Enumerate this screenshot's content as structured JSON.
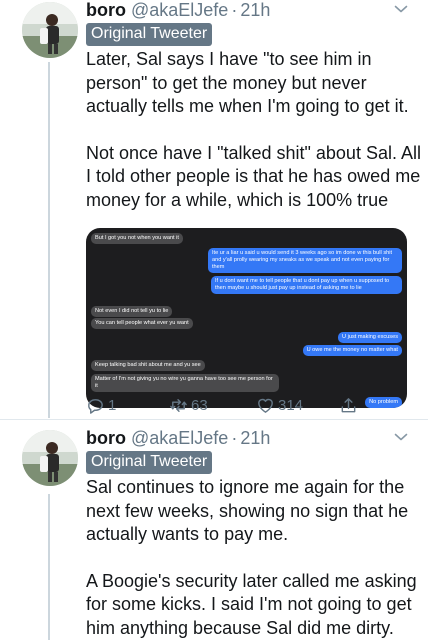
{
  "tweets": [
    {
      "name": "boro",
      "handle": "@akaElJefe",
      "time": "21h",
      "badge": "Original Tweeter",
      "lines": [
        "Later, Sal says I have \"to see him in",
        "person\" to get the money but never",
        "actually tells me when I'm going to get it.",
        "",
        "Not once have I \"talked shit\" about Sal. All",
        "I told other people is that he has owed me",
        "money for a while, which is 100% true"
      ],
      "media": {
        "messages": [
          {
            "side": "left",
            "text": "But I got you not when you want it"
          },
          {
            "side": "right",
            "text": "Ite ur a liar u said u would send it 3 weeks ago so im done w this bull shit and y'all prolly wearing my sneaks as we speak and not even paying for them"
          },
          {
            "side": "right",
            "text": "If u dont want me to tell people that u dont pay up when u supposed to then maybe u should just pay up instead of asking me to lie"
          },
          {
            "side": "left",
            "text": "Not even I did not tell yu to lie"
          },
          {
            "side": "left",
            "text": "You can tell people what ever yu want"
          },
          {
            "side": "right",
            "text": "U just making excuses"
          },
          {
            "side": "right",
            "text": "U owe me the money no matter what"
          },
          {
            "side": "left",
            "text": "Keep talking bad shit about me and yu see"
          },
          {
            "side": "left",
            "text": "Matter of I'm not giving yu no wire yu ganna have too see me person for it"
          },
          {
            "side": "right",
            "text": "No problem"
          }
        ]
      },
      "actions": {
        "reply": "1",
        "retweet": "63",
        "like": "314",
        "share": ""
      }
    },
    {
      "name": "boro",
      "handle": "@akaElJefe",
      "time": "21h",
      "badge": "Original Tweeter",
      "lines": [
        "Sal continues to ignore me again for the",
        "next few weeks, showing no sign that he",
        "actually wants to pay me.",
        "",
        "A Boogie's security later called me asking",
        "for some kicks. I said I'm not going to get",
        "him anything because Sal did me dirty."
      ]
    }
  ],
  "colors": {
    "text": "#14171a",
    "secondary": "#657786",
    "badge_bg": "#657786",
    "thread_line": "#ccd6dd",
    "imessage_blue": "#3478f6",
    "imessage_gray": "#4a4a4c",
    "media_bg": "#1d1d1f"
  },
  "icons": [
    "chevron-down-icon",
    "reply-icon",
    "retweet-icon",
    "heart-icon",
    "share-icon"
  ]
}
